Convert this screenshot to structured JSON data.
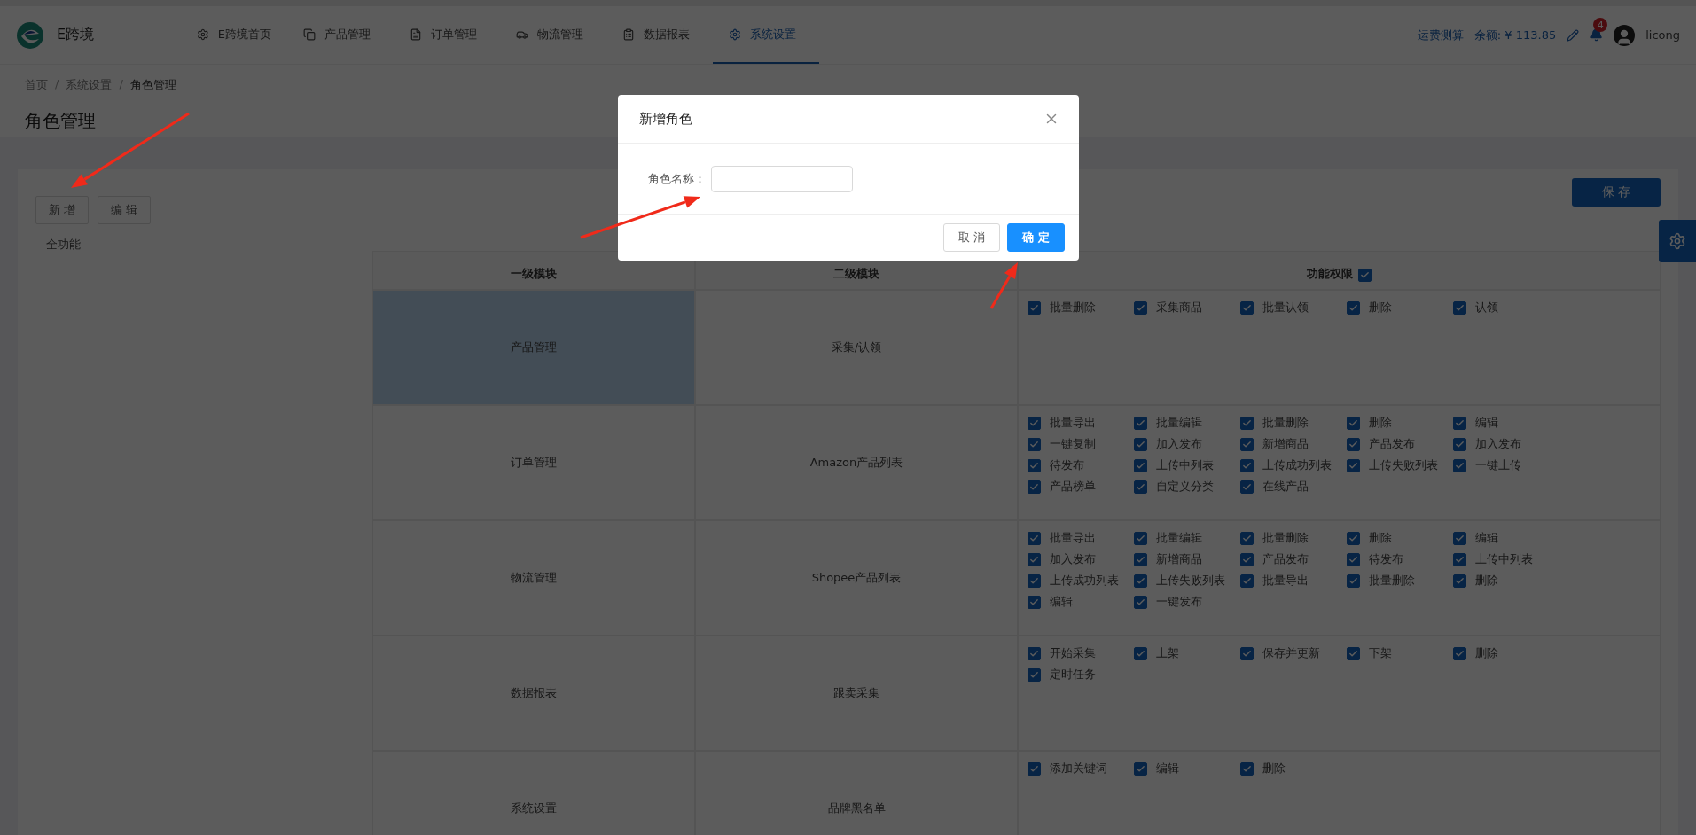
{
  "nav": {
    "brand": "E跨境",
    "items": [
      {
        "label": "E跨境首页",
        "selected": false
      },
      {
        "label": "产品管理",
        "selected": false
      },
      {
        "label": "订单管理",
        "selected": false
      },
      {
        "label": "物流管理",
        "selected": false
      },
      {
        "label": "数据报表",
        "selected": false
      },
      {
        "label": "系统设置",
        "selected": true
      }
    ]
  },
  "header_right": {
    "link": "运费测算",
    "balance": "余额: ¥ 113.85",
    "badge": "4",
    "user": "licong"
  },
  "breadcrumb": {
    "items": [
      "首页",
      "系统设置",
      "角色管理"
    ],
    "separators": [
      "/",
      "/"
    ]
  },
  "page_title": "角色管理",
  "sidebar": {
    "buttons": [
      "新 增",
      "编 辑"
    ],
    "roles": [
      {
        "label": "全功能",
        "selected": false
      }
    ]
  },
  "toolbar": {
    "save": "保 存"
  },
  "table": {
    "columns": [
      "一级模块",
      "二级模块",
      "功能权限"
    ],
    "all_checked": true,
    "rows": [
      {
        "module": "产品管理",
        "submodule": "采集/认领",
        "selected": true,
        "permissions": [
          {
            "label": "批量删除",
            "checked": true
          },
          {
            "label": "采集商品",
            "checked": true
          },
          {
            "label": "批量认领",
            "checked": true
          },
          {
            "label": "删除",
            "checked": true
          },
          {
            "label": "认领",
            "checked": true
          }
        ]
      },
      {
        "module": "订单管理",
        "submodule": "Amazon产品列表",
        "selected": false,
        "permissions": [
          {
            "label": "批量导出",
            "checked": true
          },
          {
            "label": "批量编辑",
            "checked": true
          },
          {
            "label": "批量删除",
            "checked": true
          },
          {
            "label": "删除",
            "checked": true
          },
          {
            "label": "编辑",
            "checked": true
          },
          {
            "label": "一键复制",
            "checked": true
          },
          {
            "label": "加入发布",
            "checked": true
          },
          {
            "label": "新增商品",
            "checked": true
          },
          {
            "label": "产品发布",
            "checked": true
          },
          {
            "label": "加入发布",
            "checked": true
          },
          {
            "label": "待发布",
            "checked": true
          },
          {
            "label": "上传中列表",
            "checked": true
          },
          {
            "label": "上传成功列表",
            "checked": true
          },
          {
            "label": "上传失败列表",
            "checked": true
          },
          {
            "label": "一键上传",
            "checked": true
          },
          {
            "label": "产品榜单",
            "checked": true
          },
          {
            "label": "自定义分类",
            "checked": true
          },
          {
            "label": "在线产品",
            "checked": true
          }
        ]
      },
      {
        "module": "物流管理",
        "submodule": "Shopee产品列表",
        "selected": false,
        "permissions": [
          {
            "label": "批量导出",
            "checked": true
          },
          {
            "label": "批量编辑",
            "checked": true
          },
          {
            "label": "批量删除",
            "checked": true
          },
          {
            "label": "删除",
            "checked": true
          },
          {
            "label": "编辑",
            "checked": true
          },
          {
            "label": "加入发布",
            "checked": true
          },
          {
            "label": "新增商品",
            "checked": true
          },
          {
            "label": "产品发布",
            "checked": true
          },
          {
            "label": "待发布",
            "checked": true
          },
          {
            "label": "上传中列表",
            "checked": true
          },
          {
            "label": "上传成功列表",
            "checked": true
          },
          {
            "label": "上传失败列表",
            "checked": true
          },
          {
            "label": "批量导出",
            "checked": true
          },
          {
            "label": "批量删除",
            "checked": true
          },
          {
            "label": "删除",
            "checked": true
          },
          {
            "label": "编辑",
            "checked": true
          },
          {
            "label": "一键发布",
            "checked": true
          }
        ]
      },
      {
        "module": "数据报表",
        "submodule": "跟卖采集",
        "selected": false,
        "permissions": [
          {
            "label": "开始采集",
            "checked": true
          },
          {
            "label": "上架",
            "checked": true
          },
          {
            "label": "保存并更新",
            "checked": true
          },
          {
            "label": "下架",
            "checked": true
          },
          {
            "label": "删除",
            "checked": true
          },
          {
            "label": "定时任务",
            "checked": true
          }
        ]
      },
      {
        "module": "系统设置",
        "submodule": "品牌黑名单",
        "selected": false,
        "permissions": [
          {
            "label": "添加关键词",
            "checked": true
          },
          {
            "label": "编辑",
            "checked": true
          },
          {
            "label": "删除",
            "checked": true
          }
        ]
      }
    ]
  },
  "dialog": {
    "title": "新增角色",
    "field_label": "角色名称：",
    "buttons": [
      {
        "label": "取 消",
        "kind": "default"
      },
      {
        "label": "确 定",
        "kind": "primary"
      }
    ]
  }
}
